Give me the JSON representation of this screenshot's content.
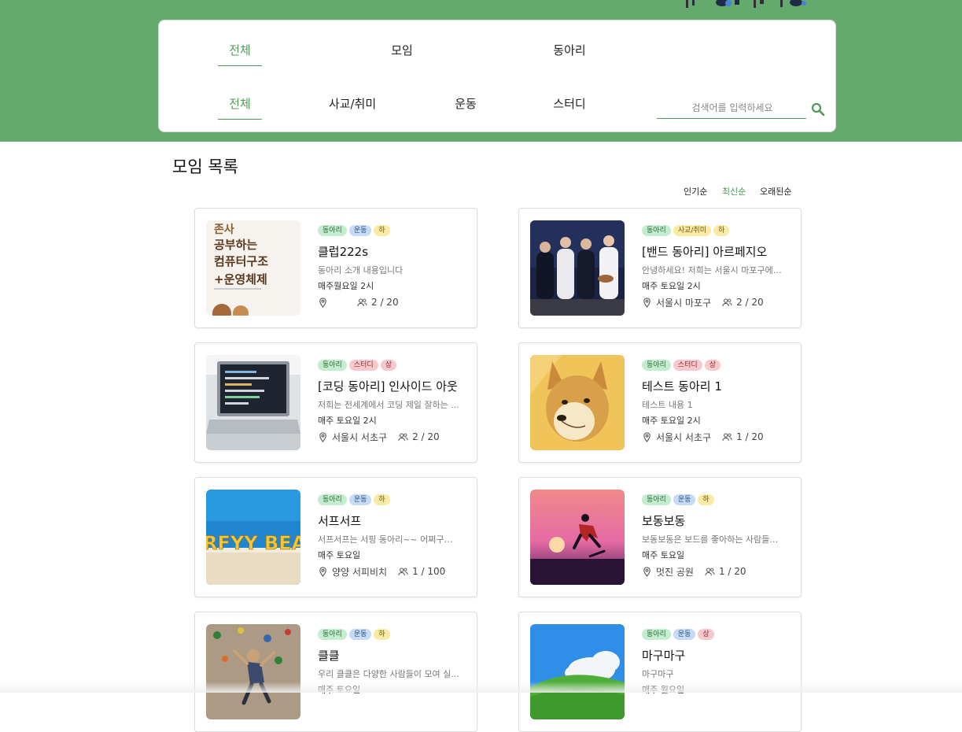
{
  "header": {
    "category_tabs": [
      {
        "label": "전체",
        "active": true
      },
      {
        "label": "모임",
        "active": false
      },
      {
        "label": "동아리",
        "active": false
      }
    ],
    "topic_tabs": [
      {
        "label": "전체",
        "active": true
      },
      {
        "label": "사교/취미",
        "active": false
      },
      {
        "label": "운동",
        "active": false
      },
      {
        "label": "스터디",
        "active": false
      }
    ],
    "search": {
      "placeholder": "검색어를 입력하세요",
      "value": "",
      "icon": "search-icon"
    },
    "colors": {
      "brand": "#64aa6c",
      "accent": "#4f9a57"
    }
  },
  "list": {
    "title": "모임 목록",
    "sort_options": [
      {
        "label": "인기순",
        "active": false
      },
      {
        "label": "최신순",
        "active": true
      },
      {
        "label": "오래된순",
        "active": false
      }
    ],
    "cards": [
      {
        "tags": [
          "동아리",
          "운동",
          "하"
        ],
        "title": "클럽222s",
        "desc": "동아리 소개 내용입니다",
        "schedule": "매주월요일 2시",
        "location": "",
        "members": "2 / 20",
        "image": "book-cover"
      },
      {
        "tags": [
          "동아리",
          "사교/취미",
          "하"
        ],
        "title": "[밴드 동아리] 아르페지오",
        "desc": "안녕하세요! 저희는 서울시 마포구에서...",
        "schedule": "매주 토요일 2시",
        "location": "서울시 마포구",
        "members": "2 / 20",
        "image": "band-photo"
      },
      {
        "tags": [
          "동아리",
          "스터디",
          "상"
        ],
        "title": "[코딩 동아리] 인사이드 아웃",
        "desc": "저희는 전세계에서 코딩 제일 잘하는 ...",
        "schedule": "매주 토요일 2시",
        "location": "서울시 서초구",
        "members": "2 / 20",
        "image": "laptop-photo"
      },
      {
        "tags": [
          "동아리",
          "스터디",
          "상"
        ],
        "title": "테스트 동아리 1",
        "desc": "테스트 내용 1",
        "schedule": "매주 토요일 2시",
        "location": "서울시 서초구",
        "members": "1 / 20",
        "image": "dog-illustration"
      },
      {
        "tags": [
          "동아리",
          "운동",
          "하"
        ],
        "title": "서프서프",
        "desc": "서프서프는 서핑 동아리~~ 어쩌구~~...",
        "schedule": "매주 토요일",
        "location": "양양 서피비치",
        "members": "1 / 100",
        "image": "beach-photo",
        "image_text": "RFYY BEA"
      },
      {
        "tags": [
          "동아리",
          "운동",
          "하"
        ],
        "title": "보동보동",
        "desc": "보동보동은 보드를 좋아하는 사람들이 ...",
        "schedule": "매주 토요일",
        "location": "멋진 공원",
        "members": "1 / 20",
        "image": "skateboard-photo"
      },
      {
        "tags": [
          "동아리",
          "운동",
          "하"
        ],
        "title": "클클",
        "desc": "우리 클클은 다양한 사람들이 모여 실...",
        "schedule": "매주 토요일",
        "location": "",
        "members": "",
        "image": "climbing-photo"
      },
      {
        "tags": [
          "동아리",
          "운동",
          "상"
        ],
        "title": "마구마구",
        "desc": "마구마구",
        "schedule": "매주 월요일",
        "location": "",
        "members": "",
        "image": "meadow-illustration"
      }
    ]
  }
}
